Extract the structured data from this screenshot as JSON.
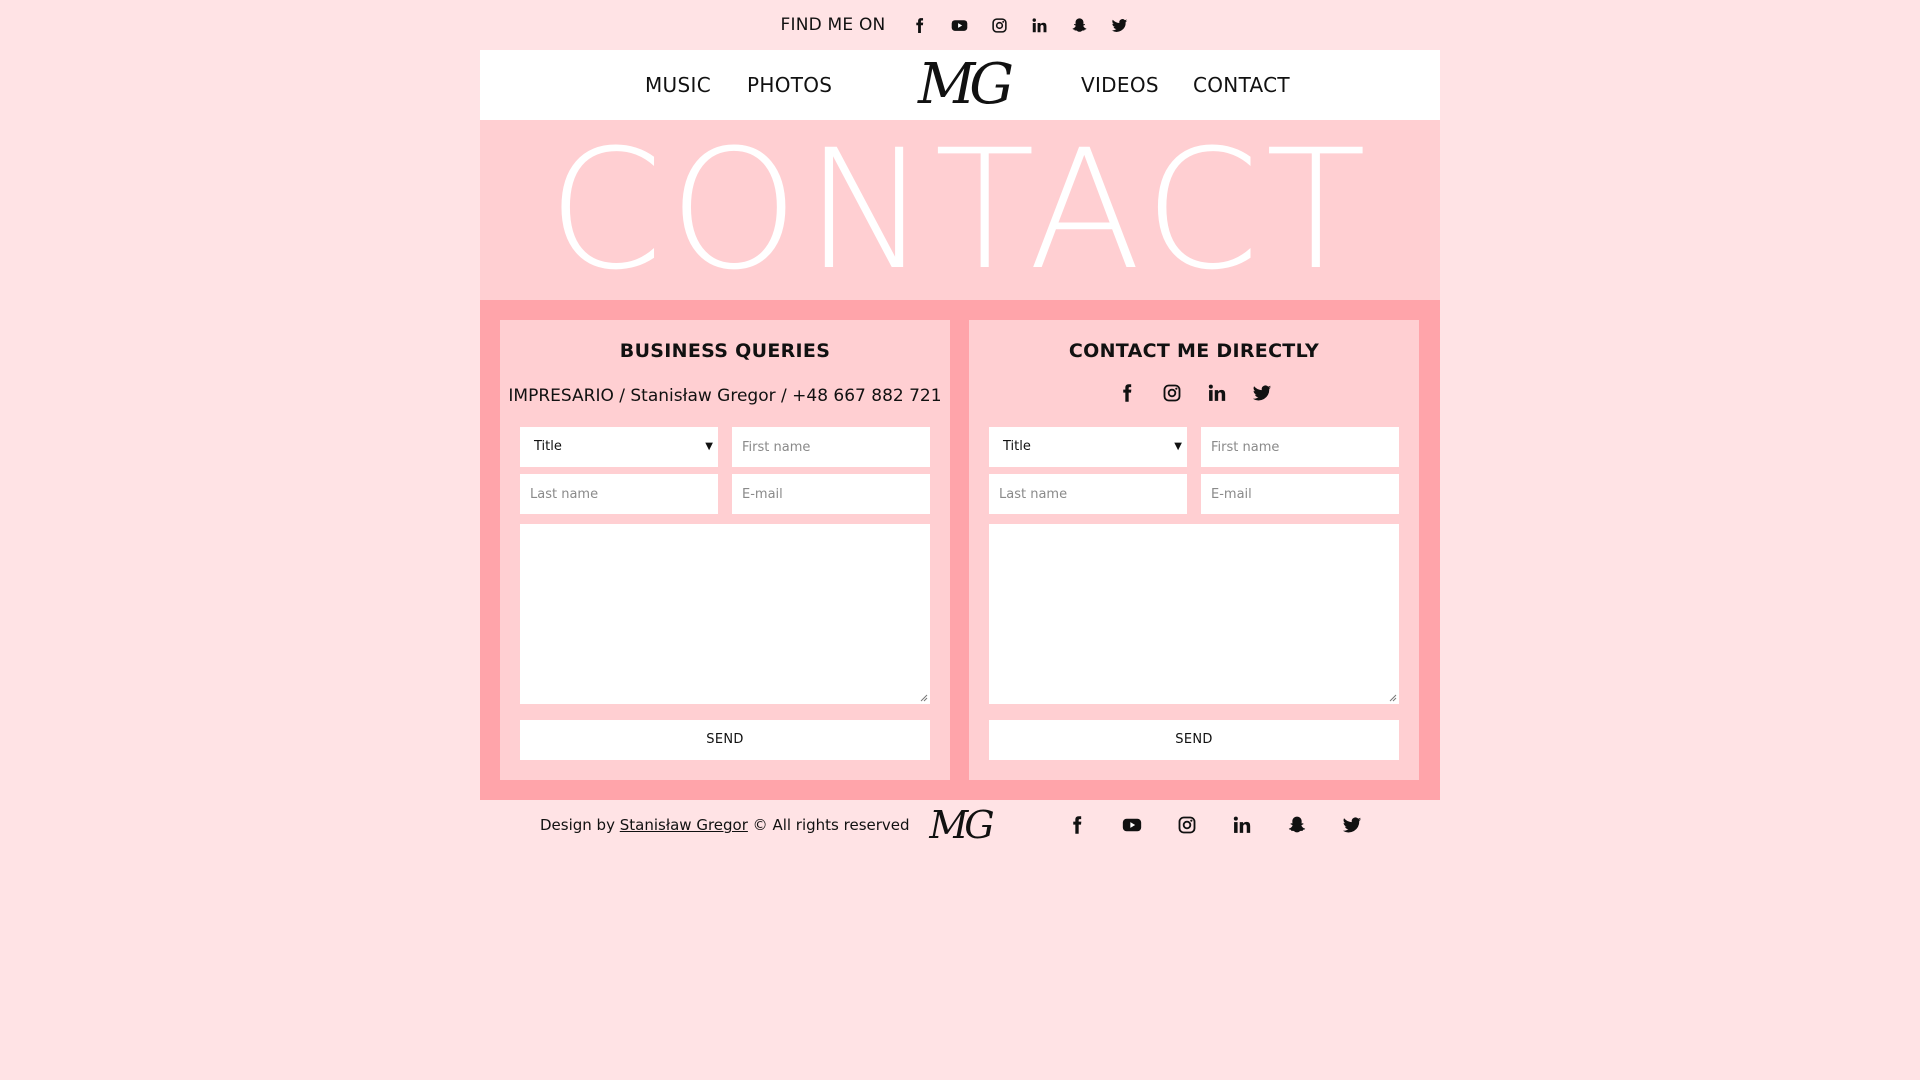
{
  "topbar": {
    "find_label": "FIND ME ON",
    "icons": [
      "facebook-icon",
      "youtube-icon",
      "instagram-icon",
      "linkedin-icon",
      "snapchat-icon",
      "twitter-icon"
    ]
  },
  "nav": {
    "music": "MUSIC",
    "photos": "PHOTOS",
    "logo": "MG",
    "videos": "VIDEOS",
    "contact": "CONTACT"
  },
  "hero": {
    "title": "CONTACT"
  },
  "business": {
    "heading": "BUSINESS QUERIES",
    "info": "IMPRESARIO / Stanisław Gregor / +48 667 882 721",
    "title_select": "Title",
    "first_name_placeholder": "First name",
    "last_name_placeholder": "Last name",
    "email_placeholder": "E-mail",
    "send_label": "SEND"
  },
  "direct": {
    "heading": "CONTACT ME DIRECTLY",
    "icons": [
      "facebook-icon",
      "instagram-icon",
      "linkedin-icon",
      "twitter-icon"
    ],
    "title_select": "Title",
    "first_name_placeholder": "First name",
    "last_name_placeholder": "Last name",
    "email_placeholder": "E-mail",
    "send_label": "SEND"
  },
  "footer": {
    "design_prefix": "Design by",
    "designer": "Stanisław Gregor",
    "rights": "© All rights reserved",
    "logo": "MG",
    "icons": [
      "facebook-icon",
      "youtube-icon",
      "instagram-icon",
      "linkedin-icon",
      "snapchat-icon",
      "twitter-icon"
    ]
  },
  "colors": {
    "page_bg": "#ffe3e5",
    "hero_bg": "#ffcfd2",
    "panel_border": "#ffa4aa",
    "card_bg": "#ffcfd2",
    "nav_bg": "#ffffff",
    "hero_text": "#ffffff"
  }
}
